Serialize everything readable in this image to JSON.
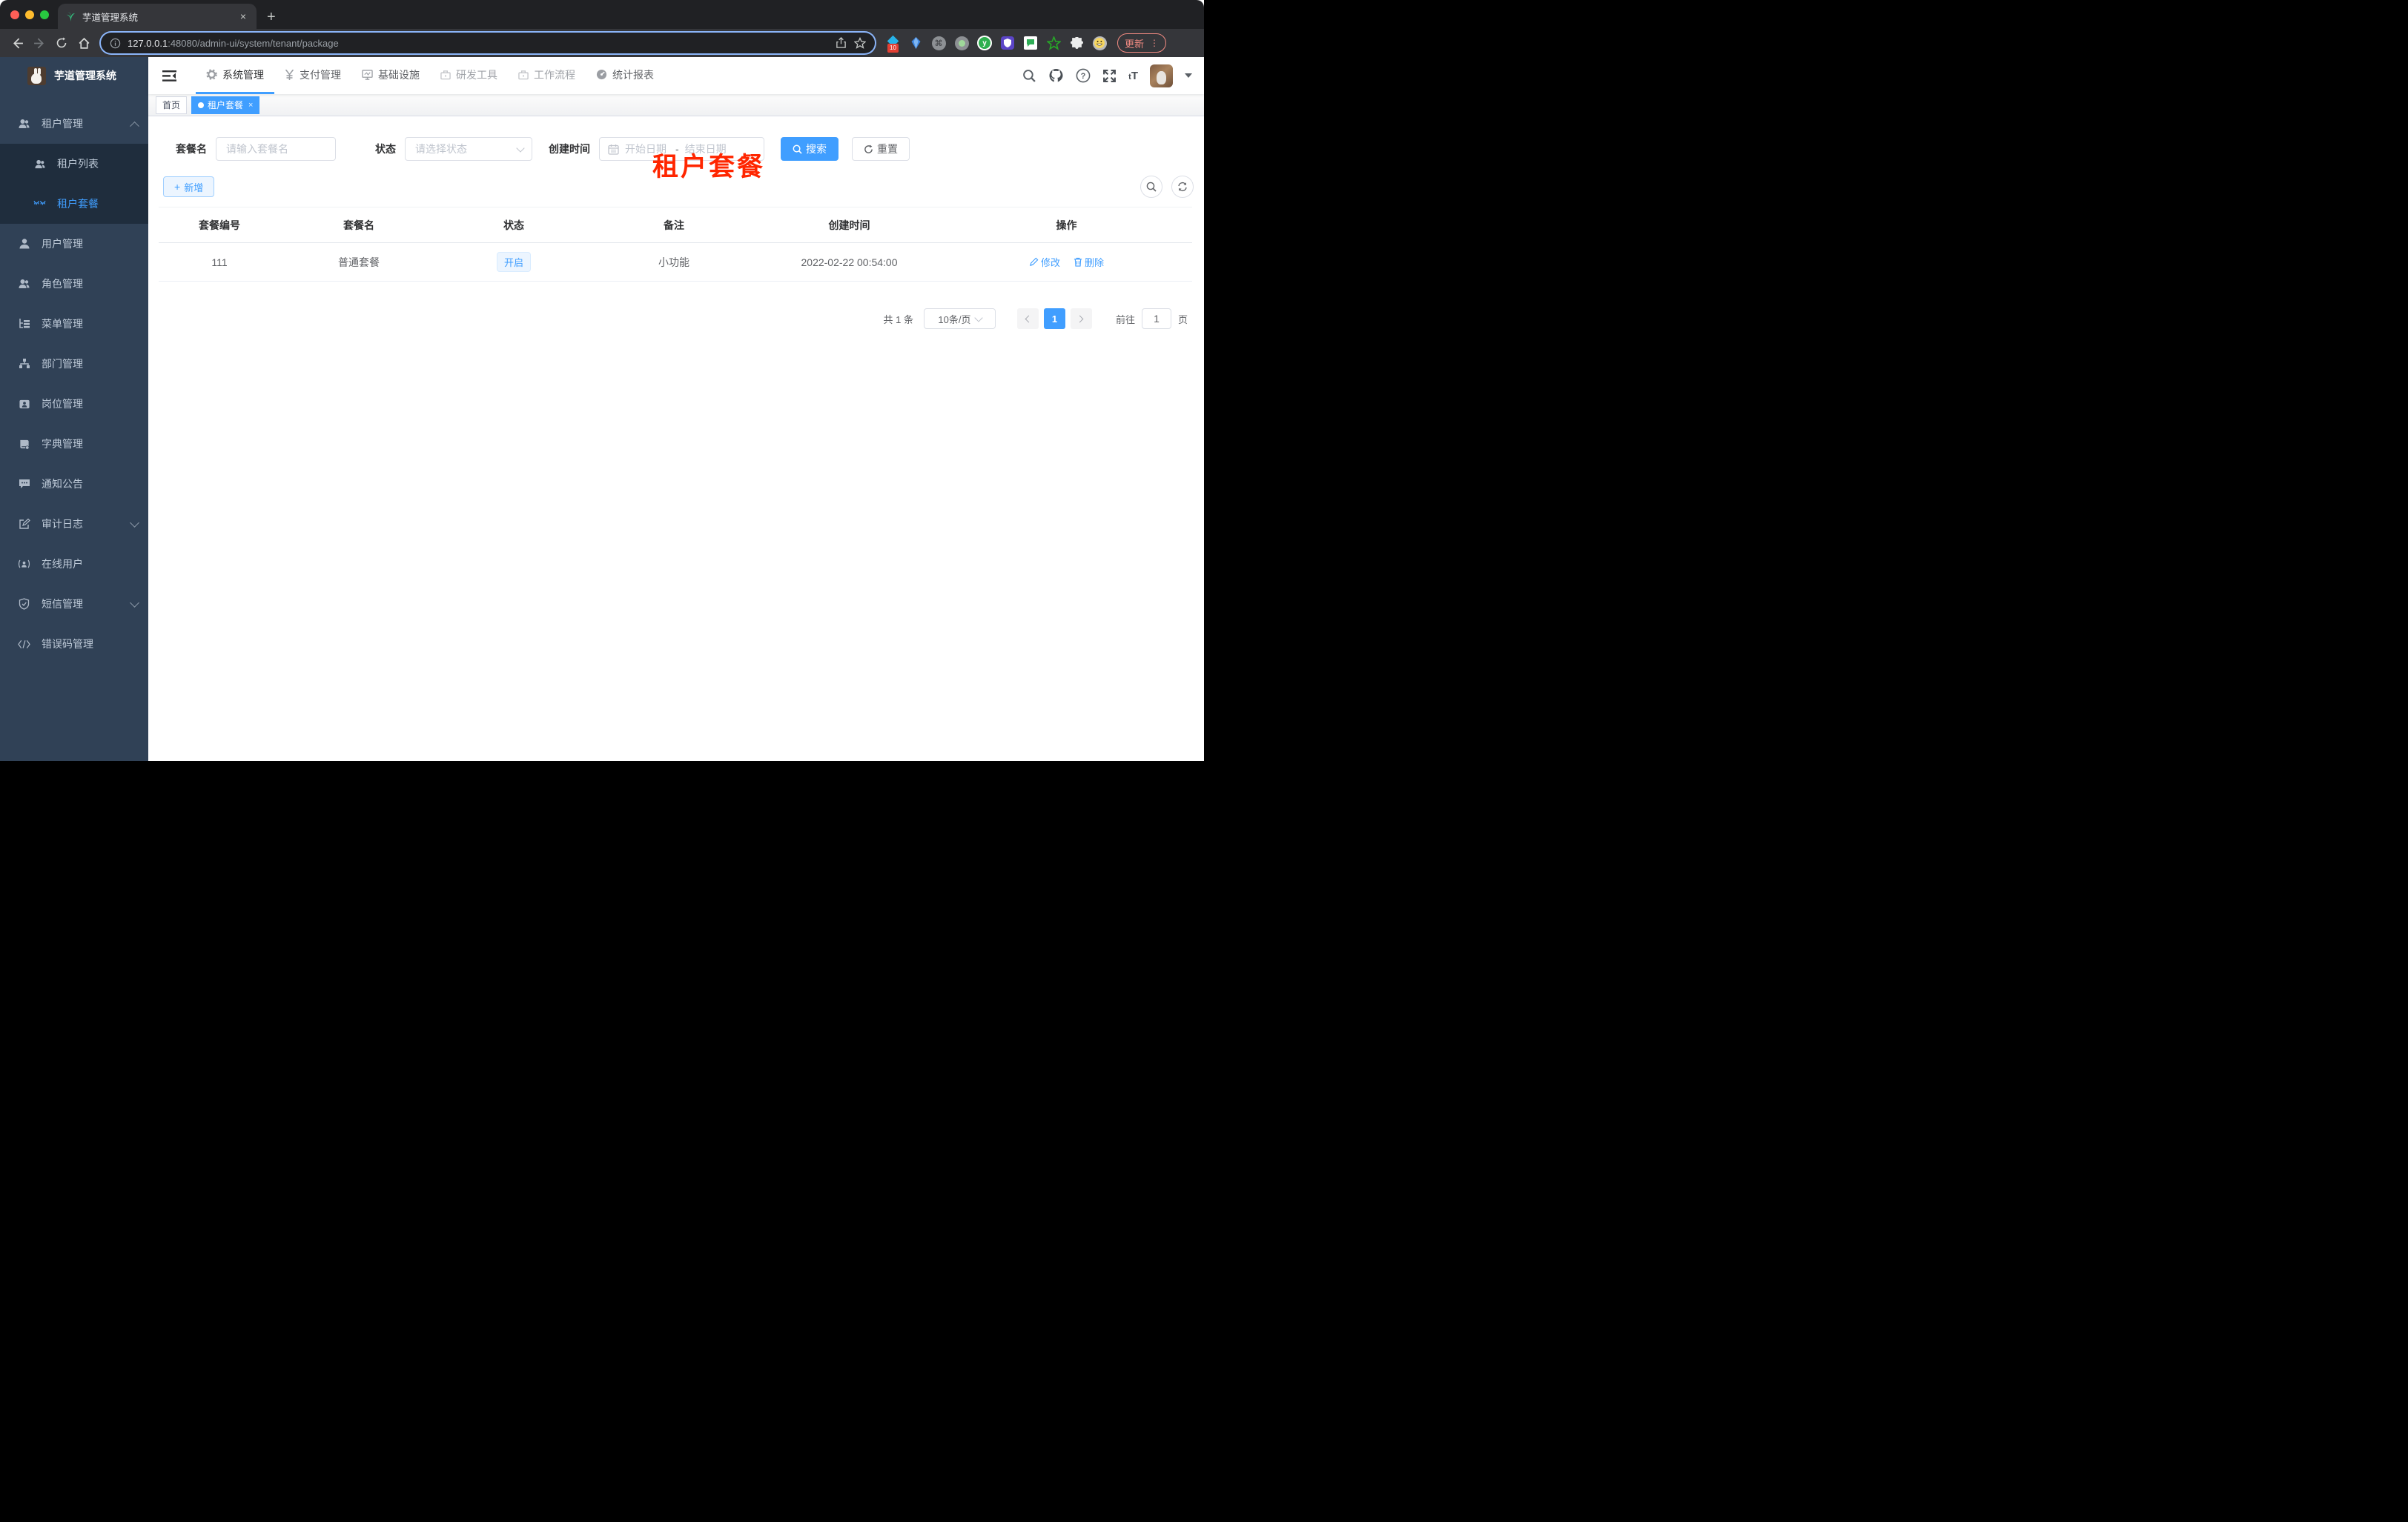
{
  "browser": {
    "tab_title": "芋道管理系统",
    "tab_close": "×",
    "new_tab": "+",
    "url_host": "127.0.0.1",
    "url_rest": ":48080/admin-ui/system/tenant/package",
    "ext_badge": "10",
    "ext_y": "y",
    "ext_cmd": "⌘",
    "update_label": "更新",
    "menu_dots": "⋮"
  },
  "sidebar": {
    "logo_title": "芋道管理系统",
    "menu": [
      {
        "label": "租户管理"
      },
      {
        "label": "租户列表"
      },
      {
        "label": "租户套餐"
      },
      {
        "label": "用户管理"
      },
      {
        "label": "角色管理"
      },
      {
        "label": "菜单管理"
      },
      {
        "label": "部门管理"
      },
      {
        "label": "岗位管理"
      },
      {
        "label": "字典管理"
      },
      {
        "label": "通知公告"
      },
      {
        "label": "审计日志"
      },
      {
        "label": "在线用户"
      },
      {
        "label": "短信管理"
      },
      {
        "label": "错误码管理"
      }
    ]
  },
  "nav": {
    "items": [
      {
        "label": "系统管理"
      },
      {
        "label": "支付管理"
      },
      {
        "label": "基础设施"
      },
      {
        "label": "研发工具"
      },
      {
        "label": "工作流程"
      },
      {
        "label": "统计报表"
      }
    ],
    "font_size_icon_text": "tT"
  },
  "tags": {
    "home": "首页",
    "current": "租户套餐",
    "close": "×"
  },
  "page": {
    "red_title": "租户套餐"
  },
  "filters": {
    "name_label": "套餐名",
    "name_placeholder": "请输入套餐名",
    "status_label": "状态",
    "status_placeholder": "请选择状态",
    "time_label": "创建时间",
    "start_placeholder": "开始日期",
    "range_sep": "-",
    "end_placeholder": "结束日期",
    "search_label": "搜索",
    "reset_label": "重置"
  },
  "toolbar": {
    "add_label": "新增"
  },
  "table": {
    "columns": [
      "套餐编号",
      "套餐名",
      "状态",
      "备注",
      "创建时间",
      "操作"
    ],
    "rows": [
      {
        "id": "111",
        "name": "普通套餐",
        "status": "开启",
        "remark": "小功能",
        "created_at": "2022-02-22 00:54:00",
        "edit_label": "修改",
        "delete_label": "删除"
      }
    ]
  },
  "pagination": {
    "total": "共 1 条",
    "page_size": "10条/页",
    "page": "1",
    "goto_label": "前往",
    "goto_value": "1",
    "unit_label": "页"
  },
  "colors": {
    "accent": "#409eff",
    "red_title": "#ff2600",
    "sidebar_bg": "#304156",
    "submenu_bg": "#1f2d3d",
    "status_tag_bg": "#ecf5ff"
  }
}
